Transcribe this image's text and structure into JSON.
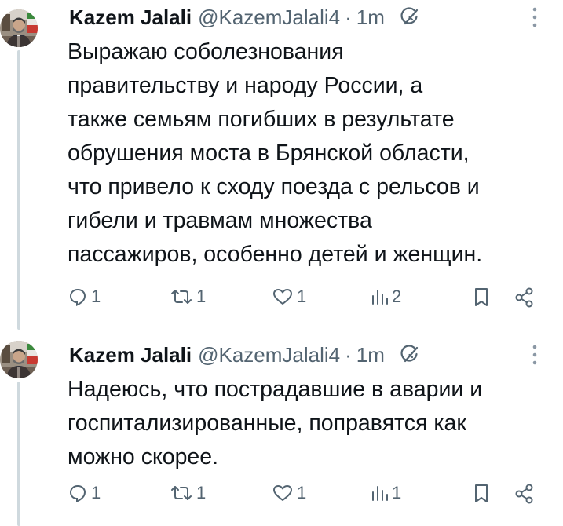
{
  "tweets": [
    {
      "author_name": "Kazem Jalali",
      "handle": "@KazemJalali4",
      "separator": "·",
      "time": "1m",
      "text": "Выражаю соболезнования\nправительству и народу России, а\nтакже семьям погибших в результате\nобрушения моста в Брянской области,\nчто привело к сходу поезда с рельсов и\nгибели и травмам множества\nпассажиров, особенно детей и женщин.",
      "replies": "1",
      "reposts": "1",
      "likes": "1",
      "views": "2"
    },
    {
      "author_name": "Kazem Jalali",
      "handle": "@KazemJalali4",
      "separator": "·",
      "time": "1m",
      "text": "Надеюсь, что пострадавшие в аварии и\nгоспитализированные, поправятся как\nможно скорее.",
      "replies": "1",
      "reposts": "1",
      "likes": "1",
      "views": "1"
    }
  ],
  "icons": {
    "grok": "grok-icon",
    "more": "more-icon",
    "reply": "reply-icon",
    "repost": "repost-icon",
    "like": "heart-icon",
    "views": "views-icon",
    "bookmark": "bookmark-icon",
    "share": "share-icon"
  },
  "colors": {
    "text": "#0f1419",
    "secondary": "#536471",
    "thread_line": "#cfd9de",
    "background": "#ffffff"
  }
}
